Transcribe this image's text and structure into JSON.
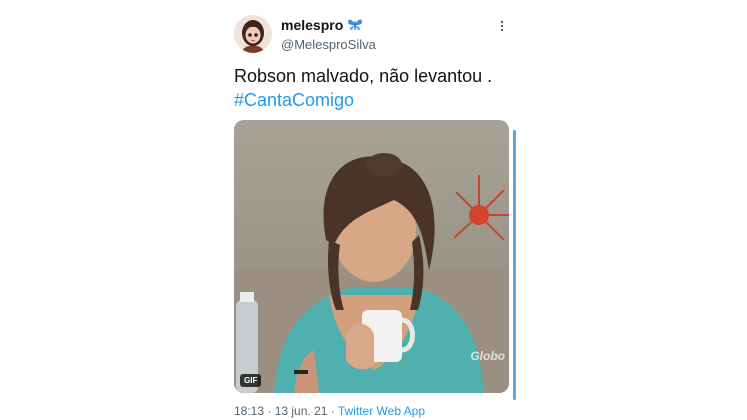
{
  "author": {
    "display_name": "melespro",
    "badge_icon": "butterfly-icon",
    "handle": "@MelesproSilva"
  },
  "tweet": {
    "text": "Robson malvado, não levantou .",
    "hashtag": "#CantaComigo"
  },
  "media": {
    "type": "gif",
    "badge": "GIF",
    "watermark": "Globo"
  },
  "meta": {
    "time": "18:13",
    "separator1": " · ",
    "date": "13 jun. 21",
    "separator2": " · ",
    "source": "Twitter Web App"
  },
  "colors": {
    "link": "#1d9bf0",
    "secondary_text": "#536471",
    "scrollbar": "#5aa9e6"
  }
}
